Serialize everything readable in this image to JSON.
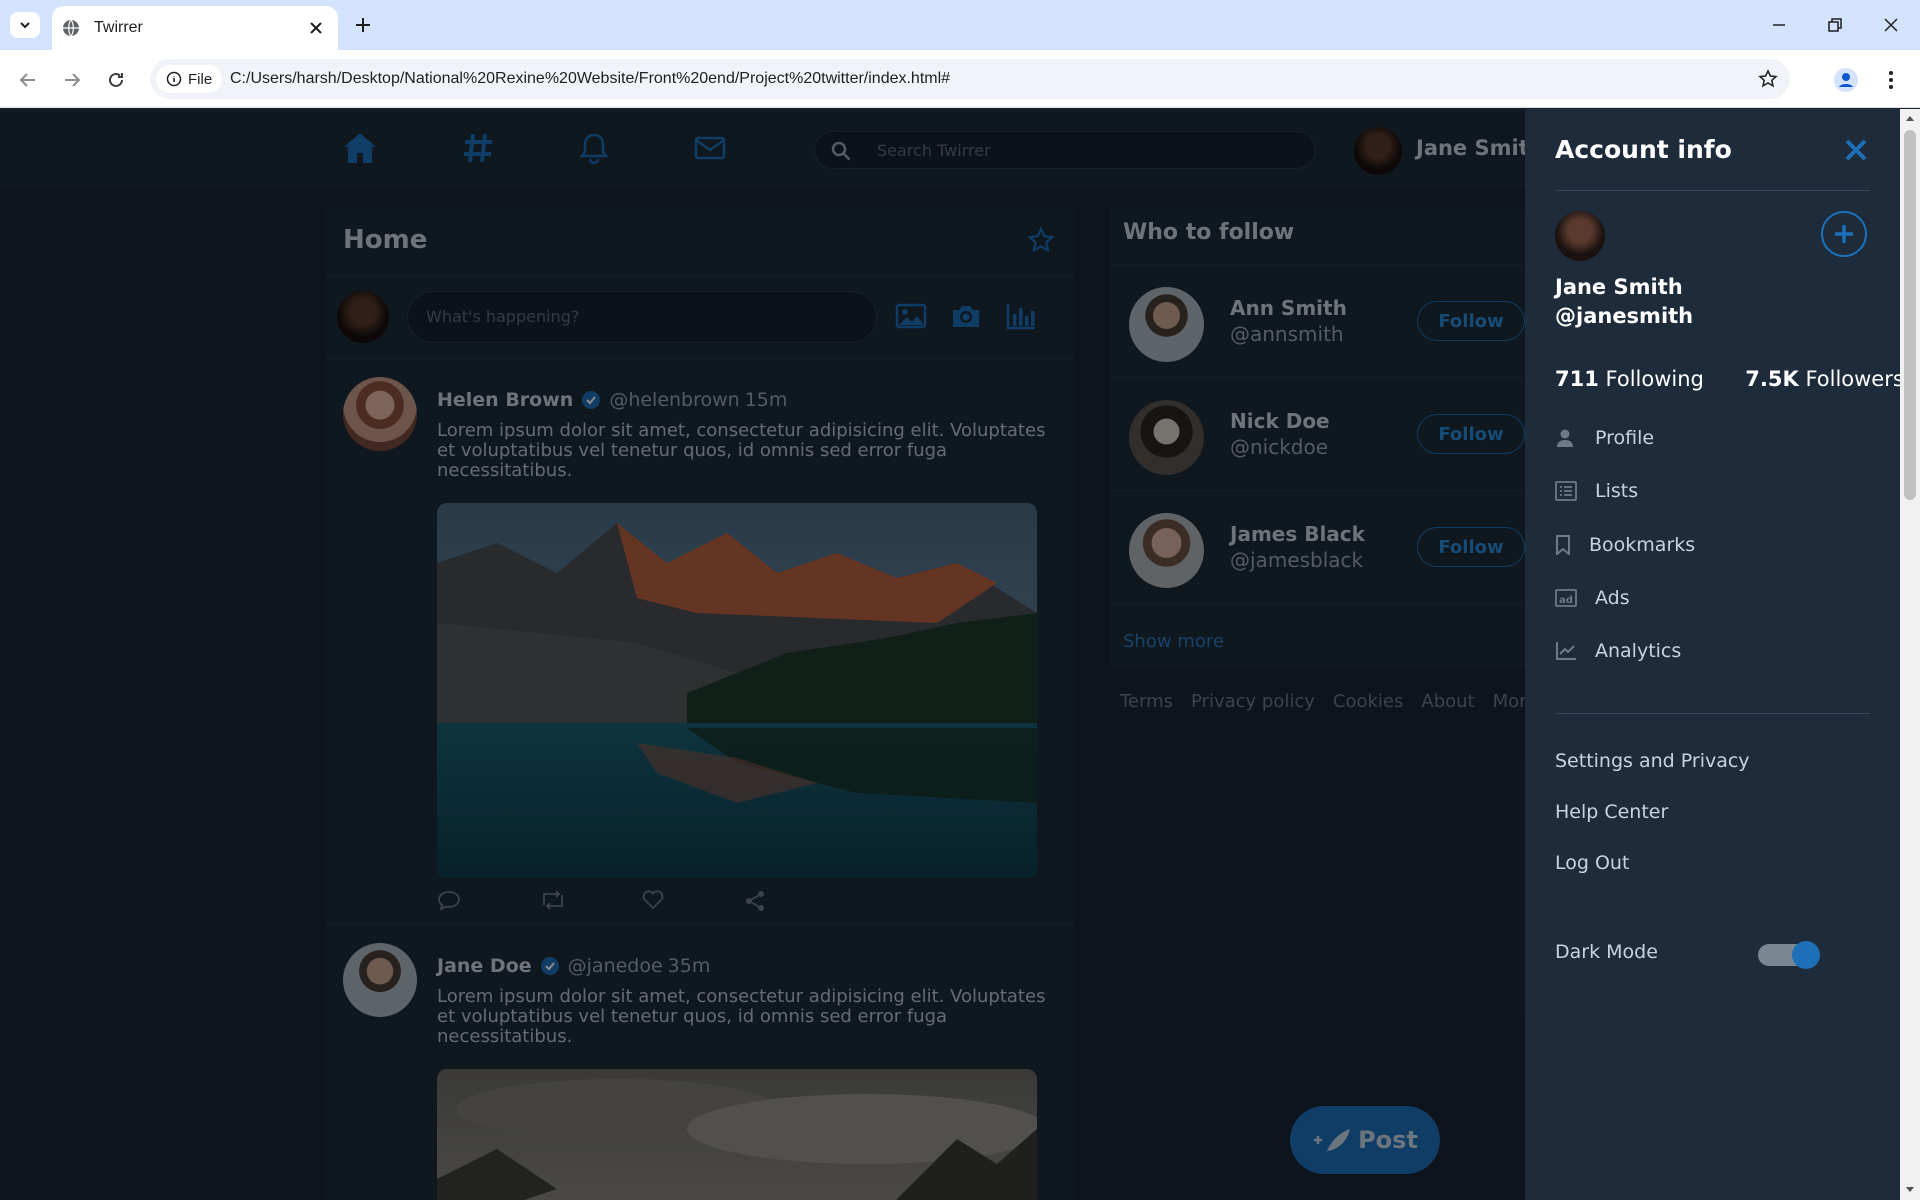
{
  "browser": {
    "tab_title": "Twirrer",
    "url_chip": "File",
    "url": "C:/Users/harsh/Desktop/National%20Rexine%20Website/Front%20end/Project%20twitter/index.html#"
  },
  "topnav": {
    "search_placeholder": "Search Twirrer",
    "user_name": "Jane Smith",
    "icons": [
      "home-icon",
      "hashtag-icon",
      "bell-icon",
      "mail-icon"
    ]
  },
  "feed": {
    "title": "Home",
    "compose_placeholder": "What's happening?",
    "posts": [
      {
        "name": "Helen Brown",
        "handle": "@helenbrown",
        "time": "15m",
        "body": "Lorem ipsum dolor sit amet, consectetur adipisicing elit. Voluptates et voluptatibus vel tenetur quos, id omnis sed error fuga necessitatibus."
      },
      {
        "name": "Jane Doe",
        "handle": "@janedoe",
        "time": "35m",
        "body": "Lorem ipsum dolor sit amet, consectetur adipisicing elit. Voluptates et voluptatibus vel tenetur quos, id omnis sed error fuga necessitatibus."
      }
    ]
  },
  "who_to_follow": {
    "title": "Who to follow",
    "users": [
      {
        "name": "Ann Smith",
        "handle": "@annsmith",
        "button": "Follow"
      },
      {
        "name": "Nick Doe",
        "handle": "@nickdoe",
        "button": "Follow"
      },
      {
        "name": "James Black",
        "handle": "@jamesblack",
        "button": "Follow"
      }
    ],
    "show_more": "Show more"
  },
  "footer_links": [
    "Terms",
    "Privacy policy",
    "Cookies",
    "About",
    "More"
  ],
  "post_button": "Post",
  "drawer": {
    "title": "Account info",
    "name": "Jane Smith",
    "handle": "@janesmith",
    "following_count": "711",
    "following_label": "Following",
    "followers_count": "7.5K",
    "followers_label": "Followers",
    "menu": [
      "Profile",
      "Lists",
      "Bookmarks",
      "Ads",
      "Analytics"
    ],
    "links": [
      "Settings and Privacy",
      "Help Center",
      "Log Out"
    ],
    "dark_mode_label": "Dark Mode",
    "dark_mode_on": true
  },
  "colors": {
    "accent": "#1d6fb8",
    "background": "#1a2634",
    "panel": "#1d2b3a"
  }
}
